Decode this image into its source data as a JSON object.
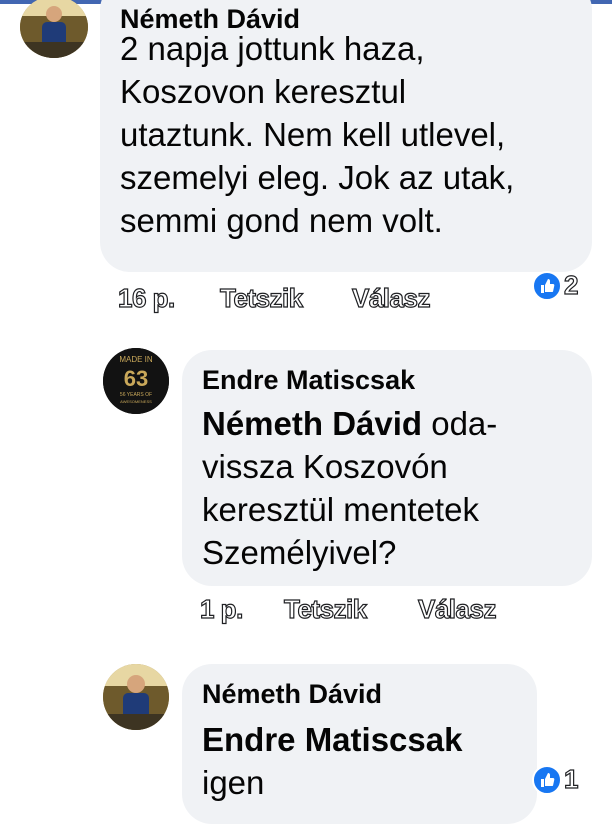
{
  "colors": {
    "accent": "#1877f2",
    "bubble": "#f0f2f5",
    "top_bar": "#4267b2"
  },
  "comments": [
    {
      "author": "Németh Dávid",
      "text_lines": [
        "2 napja jottunk haza,",
        "Koszovon keresztul",
        "utaztunk. Nem kell utlevel,",
        "szemelyi eleg. Jok az utak,",
        "semmi gond nem volt."
      ],
      "time": "16 p.",
      "like_label": "Tetszik",
      "reply_label": "Válasz",
      "reaction_icon": "like-icon",
      "reaction_count": "2"
    },
    {
      "author": "Endre Matiscsak",
      "mention": "Németh Dávid",
      "text_first": " oda-",
      "text_lines": [
        "vissza Koszovón",
        "keresztül mentetek",
        "Személyivel?"
      ],
      "time": "1 p.",
      "like_label": "Tetszik",
      "reply_label": "Válasz",
      "avatar_text": [
        "MADE IN",
        "63",
        "56 YEARS OF",
        "AWESOMENESS"
      ]
    },
    {
      "author": "Németh Dávid",
      "mention": "Endre Matiscsak",
      "text_lines": [
        "igen"
      ],
      "reaction_icon": "like-icon",
      "reaction_count": "1"
    }
  ]
}
